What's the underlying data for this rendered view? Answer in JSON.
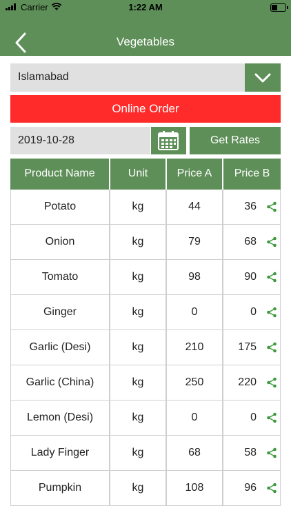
{
  "status": {
    "carrier": "Carrier",
    "time": "1:22 AM"
  },
  "header": {
    "title": "Vegetables"
  },
  "city": {
    "value": "Islamabad"
  },
  "order_button": "Online Order",
  "date": {
    "value": "2019-10-28"
  },
  "get_rates_button": "Get Rates",
  "colors": {
    "primary": "#5e8f58",
    "accent_red": "#ff2a2a",
    "field_bg": "#e0e0e0",
    "share_icon": "#3e9a3e"
  },
  "table": {
    "headers": [
      "Product Name",
      "Unit",
      "Price A",
      "Price B"
    ],
    "rows": [
      {
        "name": "Potato",
        "unit": "kg",
        "price_a": "44",
        "price_b": "36"
      },
      {
        "name": "Onion",
        "unit": "kg",
        "price_a": "79",
        "price_b": "68"
      },
      {
        "name": "Tomato",
        "unit": "kg",
        "price_a": "98",
        "price_b": "90"
      },
      {
        "name": "Ginger",
        "unit": "kg",
        "price_a": "0",
        "price_b": "0"
      },
      {
        "name": "Garlic (Desi)",
        "unit": "kg",
        "price_a": "210",
        "price_b": "175"
      },
      {
        "name": "Garlic (China)",
        "unit": "kg",
        "price_a": "250",
        "price_b": "220"
      },
      {
        "name": "Lemon (Desi)",
        "unit": "kg",
        "price_a": "0",
        "price_b": "0"
      },
      {
        "name": "Lady Finger",
        "unit": "kg",
        "price_a": "68",
        "price_b": "58"
      },
      {
        "name": "Pumpkin",
        "unit": "kg",
        "price_a": "108",
        "price_b": "96"
      }
    ]
  }
}
